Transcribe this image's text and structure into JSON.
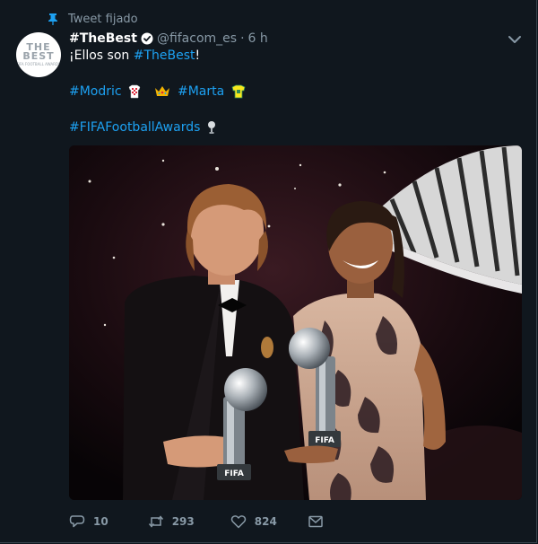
{
  "pinned": {
    "label": "Tweet fijado"
  },
  "tweet": {
    "display_name": "#TheBest",
    "handle": "@fifacom_es",
    "separator": "·",
    "time": "6 h",
    "avatar": {
      "line1": "THE",
      "line2": "BEST",
      "line3": "FIFA FOOTBALL AWARDS"
    },
    "line1": {
      "prefix": "¡Ellos son ",
      "hashtag": "#TheBest",
      "suffix": "!"
    },
    "line2": {
      "tag1": "#Modric",
      "tag2": "#Marta"
    },
    "line3": {
      "tag": "#FIFAFootballAwards"
    },
    "photo": {
      "trophy_brand": "FIFA"
    }
  },
  "actions": {
    "replies": "10",
    "retweets": "293",
    "likes": "824"
  },
  "colors": {
    "background": "#10171e",
    "accent": "#1da1f2",
    "secondary_text": "#8899a6",
    "border": "#38444d"
  },
  "icons": [
    "pin-icon",
    "verified-icon",
    "chevron-down-icon",
    "reply-icon",
    "retweet-icon",
    "like-icon",
    "message-icon"
  ]
}
